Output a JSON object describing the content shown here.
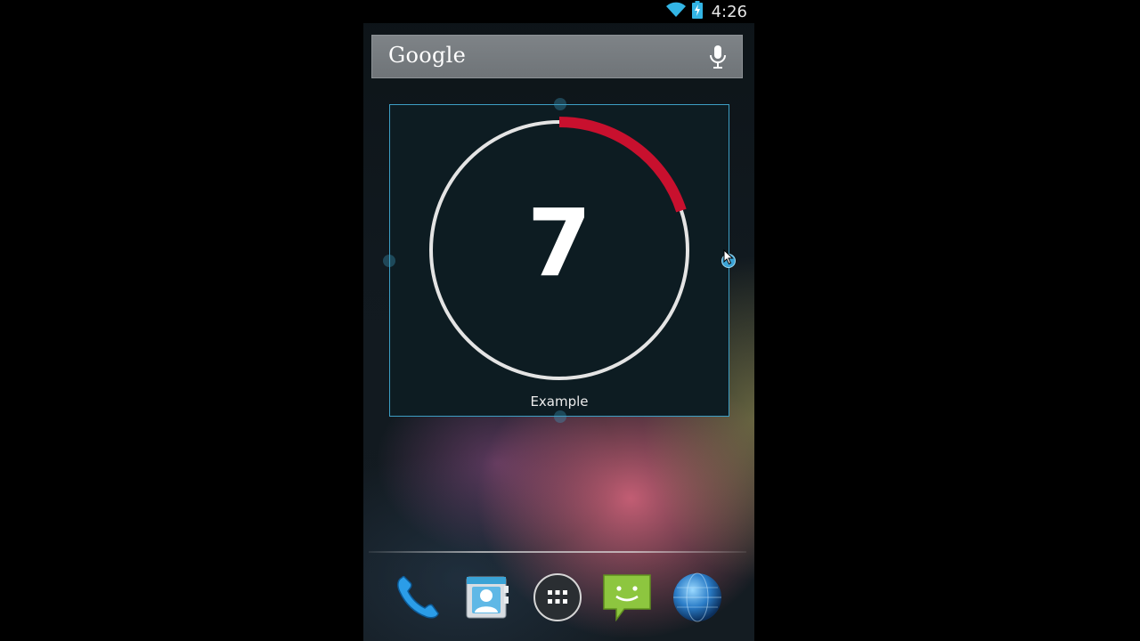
{
  "status_bar": {
    "time": "4:26",
    "icons": [
      "wifi-icon",
      "battery-charging-icon"
    ]
  },
  "search": {
    "logo_text": "Google",
    "icons": [
      "mic-icon"
    ]
  },
  "widget": {
    "value": "7",
    "label": "Example",
    "progress_fraction": 0.2,
    "colors": {
      "ring": "#e4e4e4",
      "progress": "#c8102e",
      "frame": "#3d9ec4"
    }
  },
  "dock": {
    "items": [
      {
        "icon": "phone-icon"
      },
      {
        "icon": "contacts-icon"
      },
      {
        "icon": "app-drawer-icon"
      },
      {
        "icon": "messaging-icon"
      },
      {
        "icon": "browser-icon"
      }
    ]
  }
}
